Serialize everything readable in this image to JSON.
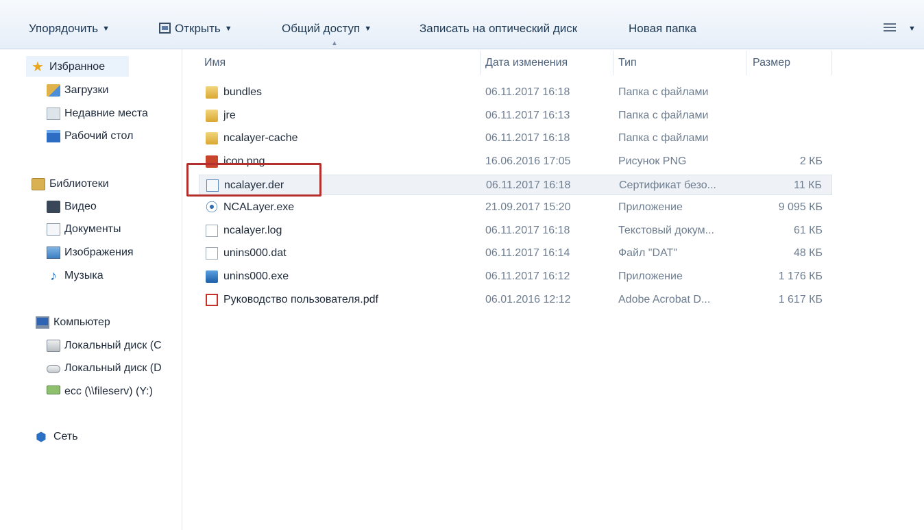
{
  "toolbar": {
    "organize": "Упорядочить",
    "open": "Открыть",
    "share": "Общий доступ",
    "burn": "Записать на оптический диск",
    "new_folder": "Новая папка"
  },
  "nav": {
    "favorites": "Избранное",
    "downloads": "Загрузки",
    "recent": "Недавние места",
    "desktop": "Рабочий стол",
    "libraries": "Библиотеки",
    "video": "Видео",
    "documents": "Документы",
    "images": "Изображения",
    "music": "Музыка",
    "computer": "Компьютер",
    "disk_c": "Локальный диск (C",
    "disk_d": "Локальный диск (D",
    "net_drive": "ecc (\\\\fileserv) (Y:)",
    "network": "Сеть"
  },
  "columns": {
    "name": "Имя",
    "date": "Дата изменения",
    "type": "Тип",
    "size": "Размер"
  },
  "files": [
    {
      "name": "bundles",
      "date": "06.11.2017 16:18",
      "type": "Папка с файлами",
      "size": "",
      "icon": "folder-icon"
    },
    {
      "name": "jre",
      "date": "06.11.2017 16:13",
      "type": "Папка с файлами",
      "size": "",
      "icon": "folder-icon"
    },
    {
      "name": "ncalayer-cache",
      "date": "06.11.2017 16:18",
      "type": "Папка с файлами",
      "size": "",
      "icon": "folder-icon"
    },
    {
      "name": "icon.png",
      "date": "16.06.2016 17:05",
      "type": "Рисунок PNG",
      "size": "2 КБ",
      "icon": "png-file-icon"
    },
    {
      "name": "ncalayer.der",
      "date": "06.11.2017 16:18",
      "type": "Сертификат безо...",
      "size": "11 КБ",
      "icon": "certificate-icon"
    },
    {
      "name": "NCALayer.exe",
      "date": "21.09.2017 15:20",
      "type": "Приложение",
      "size": "9 095 КБ",
      "icon": "ncalayer-app-icon"
    },
    {
      "name": "ncalayer.log",
      "date": "06.11.2017 16:18",
      "type": "Текстовый докум...",
      "size": "61 КБ",
      "icon": "text-file-icon"
    },
    {
      "name": "unins000.dat",
      "date": "06.11.2017 16:14",
      "type": "Файл \"DAT\"",
      "size": "48 КБ",
      "icon": "dat-file-icon"
    },
    {
      "name": "unins000.exe",
      "date": "06.11.2017 16:12",
      "type": "Приложение",
      "size": "1 176 КБ",
      "icon": "setup-exe-icon"
    },
    {
      "name": "Руководство пользователя.pdf",
      "date": "06.01.2016 12:12",
      "type": "Adobe Acrobat D...",
      "size": "1 617 КБ",
      "icon": "pdf-file-icon"
    }
  ]
}
